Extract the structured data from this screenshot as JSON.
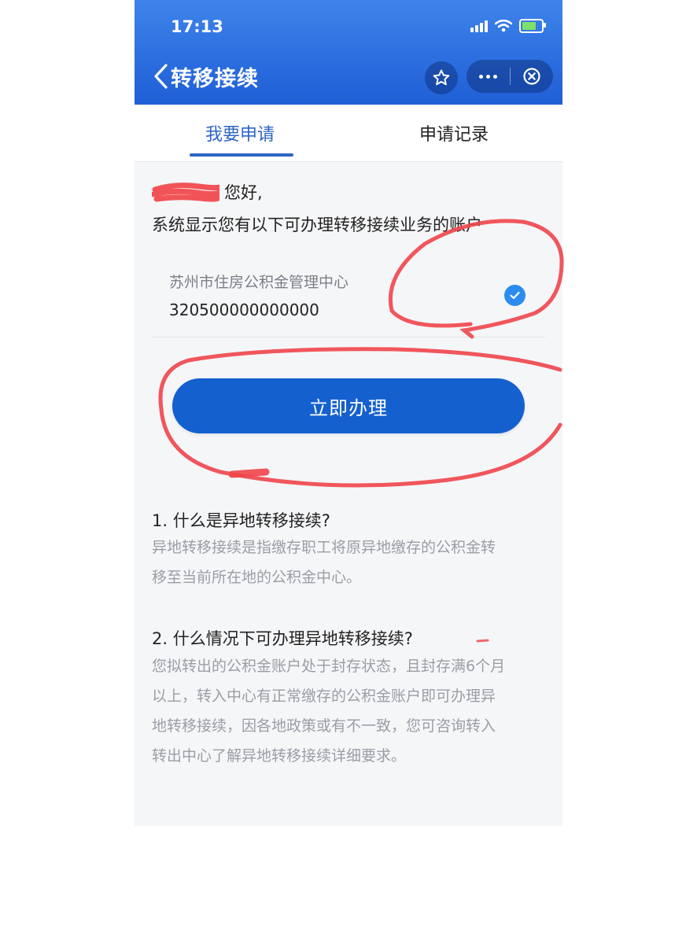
{
  "status_bar": {
    "time": "17:13"
  },
  "nav": {
    "title": "转移接续",
    "icons": [
      "chevron-left-icon",
      "star-icon",
      "more-icon",
      "close-icon"
    ]
  },
  "tabs": [
    {
      "label": "我要申请",
      "active": true
    },
    {
      "label": "申请记录",
      "active": false
    }
  ],
  "greeting": {
    "hello": "您好,",
    "message": "系统显示您有以下可办理转移接续业务的账户"
  },
  "account": {
    "org": "苏州市住房公积金管理中心",
    "number": "320500000000000",
    "selected": true
  },
  "apply_button": "立即办理",
  "faq": [
    {
      "q": "1. 什么是异地转移接续?",
      "a_lines": [
        "异地转移接续是指缴存职工将原异地缴存的公积金转",
        "移至当前所在地的公积金中心。"
      ]
    },
    {
      "q": "2. 什么情况下可办理异地转移接续?",
      "a_lines": [
        "您拟转出的公积金账户处于封存状态，且封存满6个月",
        "以上，转入中心有正常缴存的公积金账户即可办理异",
        "地转移接续，因各地政策或有不一致，您可咨询转入",
        "转出中心了解异地转移接续详细要求。"
      ]
    }
  ],
  "colors": {
    "primary": "#1560cf",
    "tab_active": "#2d65c4",
    "annotation": "#f0454a"
  }
}
